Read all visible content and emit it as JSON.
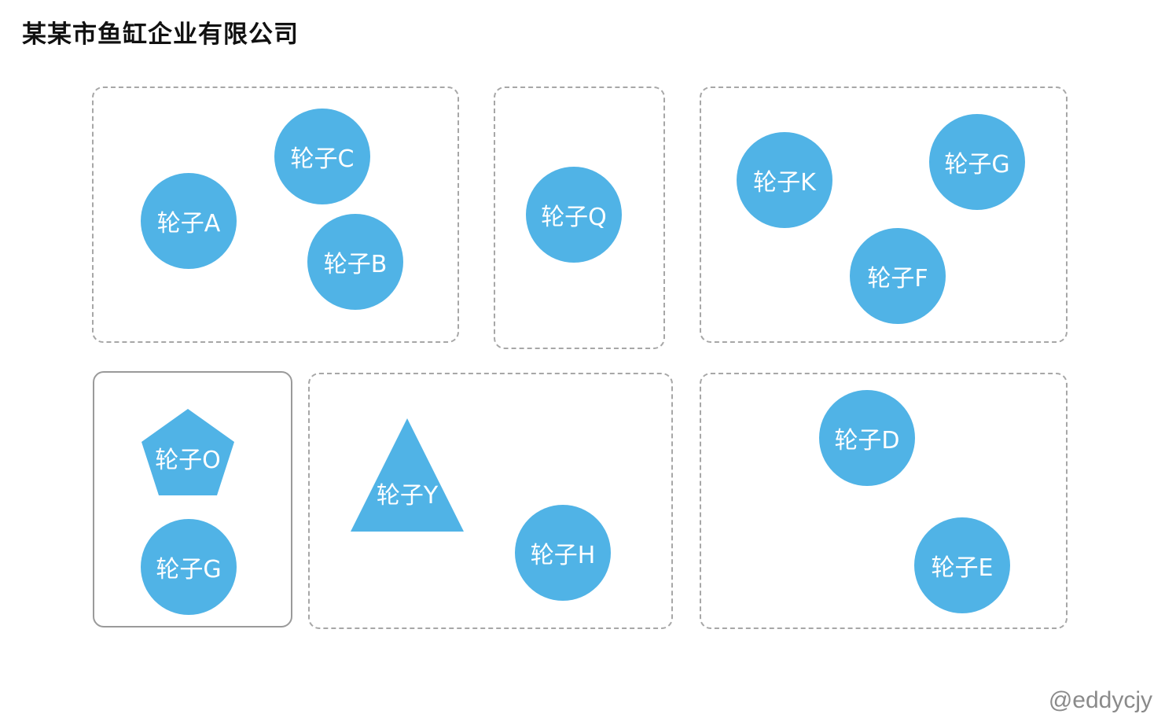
{
  "title": "某某市鱼缸企业有限公司",
  "watermark": "@eddycjy",
  "colors": {
    "node_fill": "#50b3e6",
    "node_text": "#ffffff",
    "group_border": "#a7a7a7"
  },
  "groups": [
    {
      "style": "dashed",
      "nodes": [
        "轮子A",
        "轮子C",
        "轮子B"
      ]
    },
    {
      "style": "dashed",
      "nodes": [
        "轮子Q"
      ]
    },
    {
      "style": "dashed",
      "nodes": [
        "轮子K",
        "轮子G",
        "轮子F"
      ]
    },
    {
      "style": "solid",
      "nodes": [
        "轮子O",
        "轮子G"
      ]
    },
    {
      "style": "dashed",
      "nodes": [
        "轮子Y",
        "轮子H"
      ]
    },
    {
      "style": "dashed",
      "nodes": [
        "轮子D",
        "轮子E"
      ]
    }
  ]
}
